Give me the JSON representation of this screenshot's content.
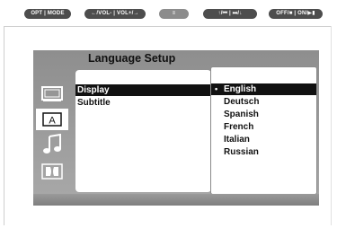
{
  "top_buttons": [
    {
      "label": "OPT | MODE"
    },
    {
      "label": "←/VOL- | VOL+/→"
    },
    {
      "label": "≡"
    },
    {
      "label": "↑/⏮ | ⏭/↓"
    },
    {
      "label": "OFF/■ | ON/▶▮"
    }
  ],
  "osd": {
    "title": "Language Setup",
    "menu_items": [
      {
        "label": "Display",
        "selected": true
      },
      {
        "label": "Subtitle",
        "selected": false
      }
    ],
    "options": [
      {
        "label": "English",
        "selected": true,
        "bullet": "•"
      },
      {
        "label": "Deutsch",
        "selected": false
      },
      {
        "label": "Spanish",
        "selected": false
      },
      {
        "label": "French",
        "selected": false
      },
      {
        "label": "Italian",
        "selected": false
      },
      {
        "label": "Russian",
        "selected": false
      }
    ],
    "icons": [
      "tv-screen-icon",
      "audio-language-icon",
      "music-note-icon",
      "dolby-icon"
    ],
    "active_icon": "audio-language-icon",
    "audio_icon_label": "A"
  },
  "colors": {
    "panel_bg": "#9b9b9b",
    "highlight": "#111111"
  }
}
